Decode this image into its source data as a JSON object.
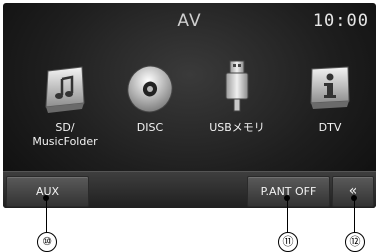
{
  "header": {
    "title": "AV",
    "clock": "10:00"
  },
  "sources": [
    {
      "label": "SD/\nMusicFolder",
      "icon": "music-folder-icon"
    },
    {
      "label": "DISC",
      "icon": "disc-icon"
    },
    {
      "label": "USBメモリ",
      "icon": "usb-memory-icon"
    },
    {
      "label": "DTV",
      "icon": "dtv-info-icon"
    }
  ],
  "bottombar": {
    "aux_label": "AUX",
    "pant_label": "P.ANT OFF",
    "back_label": "«"
  },
  "callouts": [
    "⑩",
    "⑪",
    "⑫"
  ]
}
